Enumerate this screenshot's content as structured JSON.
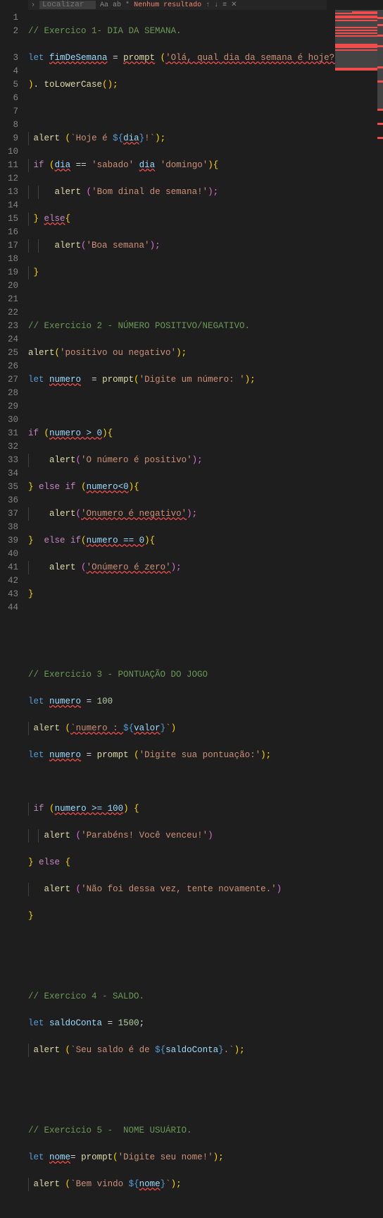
{
  "find": {
    "placeholder": "Localizar",
    "icons": [
      "Aa",
      "ab",
      "*"
    ],
    "result": "Nenhum resultado",
    "close": "✕"
  },
  "lines": {
    "l1": "// Exercico 1- DIA DA SEMANA.",
    "l2a": "let",
    "l2b": "fimDeSemana",
    "l2c": "=",
    "l2d": "prompt",
    "l2e": "(",
    "l2f": "'Olá, qual dia da semana é hoje?'",
    "l2g": ")",
    "l2h": ".",
    "l2i": "toLowerCase",
    "l2j": "();",
    "l4a": "alert",
    "l4b": "(",
    "l4c": "`Hoje é ",
    "l4d": "${",
    "l4e": "dia",
    "l4f": "}",
    "l4g": "!`",
    "l4h": ");",
    "l5a": "if",
    "l5b": "(",
    "l5c": "dia",
    "l5d": "==",
    "l5e": "'sabado'",
    "l5f": "dia",
    "l5g": "'domingo'",
    "l5h": "){",
    "l6a": "alert",
    "l6b": "(",
    "l6c": "'Bom dinal de semana!'",
    "l6d": ");",
    "l7a": "}",
    "l7b": "else",
    "l7c": "{",
    "l8a": "alert",
    "l8b": "(",
    "l8c": "'Boa semana'",
    "l8d": ");",
    "l9a": "}",
    "l11": "// Exercicio 2 - NÚMERO POSITIVO/NEGATIVO.",
    "l12a": "alert",
    "l12b": "(",
    "l12c": "'positivo ou negativo'",
    "l12d": ");",
    "l13a": "let",
    "l13b": "numero",
    "l13c": "=",
    "l13d": "prompt",
    "l13e": "(",
    "l13f": "'Digite um número: '",
    "l13g": ");",
    "l15a": "if",
    "l15b": "(",
    "l15c": "numero > 0",
    "l15d": "){",
    "l16a": "alert",
    "l16b": "(",
    "l16c": "'O número é positivo'",
    "l16d": ");",
    "l17a": "}",
    "l17b": "else if",
    "l17c": "(",
    "l17d": "numero<0",
    "l17e": "){",
    "l18a": "alert",
    "l18b": "(",
    "l18c": "'Onumero é negativo'",
    "l18d": ");",
    "l19a": "}",
    "l19b": "else if",
    "l19c": "(",
    "l19d": "numero == 0",
    "l19e": "){",
    "l20a": "alert",
    "l20b": "(",
    "l20c": "'Onúmero é zero'",
    "l20d": ");",
    "l21a": "}",
    "l24": "// Exercicio 3 - PONTUAÇÃO DO JOGO",
    "l25a": "let",
    "l25b": "numero",
    "l25c": "=",
    "l25d": "100",
    "l26a": "alert",
    "l26b": "(",
    "l26c": "`numero : ",
    "l26d": "${",
    "l26e": "valor",
    "l26f": "}",
    "l26g": "`",
    "l26h": ")",
    "l27a": "let",
    "l27b": "numero",
    "l27c": "=",
    "l27d": "prompt",
    "l27e": "(",
    "l27f": "'Digite sua pontuação:'",
    "l27g": ");",
    "l29a": "if",
    "l29b": "(",
    "l29c": "numero >= 100",
    "l29d": ")",
    "l29e": "{",
    "l30a": "alert",
    "l30b": "(",
    "l30c": "'Parabéns! Você venceu!'",
    "l30d": ")",
    "l31a": "}",
    "l31b": "else",
    "l31c": "{",
    "l32a": "alert",
    "l32b": "(",
    "l32c": "'Não foi dessa vez, tente novamente.'",
    "l32d": ")",
    "l33a": "}",
    "l36": "// Exercico 4 - SALDO.",
    "l37a": "let",
    "l37b": "saldoConta",
    "l37c": "=",
    "l37d": "1500",
    "l37e": ";",
    "l38a": "alert",
    "l38b": "(",
    "l38c": "`Seu saldo é de ",
    "l38d": "${",
    "l38e": "saldoConta",
    "l38f": "}",
    "l38g": ".`",
    "l38h": ");",
    "l41": "// Exercicio 5 -  NOME USUÁRIO.",
    "l42a": "let",
    "l42b": "nome",
    "l42c": "=",
    "l42d": "prompt",
    "l42e": "(",
    "l42f": "'Digite seu nome!'",
    "l42g": ");",
    "l43a": "alert",
    "l43b": "(",
    "l43c": "`Bem vindo ",
    "l43d": "${",
    "l43e": "nome",
    "l43f": "}",
    "l43g": "`",
    "l43h": ");"
  },
  "line_numbers": [
    "1",
    "2",
    "3",
    "4",
    "5",
    "6",
    "7",
    "8",
    "9",
    "10",
    "11",
    "12",
    "13",
    "14",
    "15",
    "16",
    "17",
    "18",
    "19",
    "20",
    "21",
    "22",
    "23",
    "24",
    "25",
    "26",
    "27",
    "28",
    "29",
    "30",
    "31",
    "32",
    "33",
    "34",
    "35",
    "36",
    "37",
    "38",
    "39",
    "40",
    "41",
    "42",
    "43",
    "44"
  ]
}
